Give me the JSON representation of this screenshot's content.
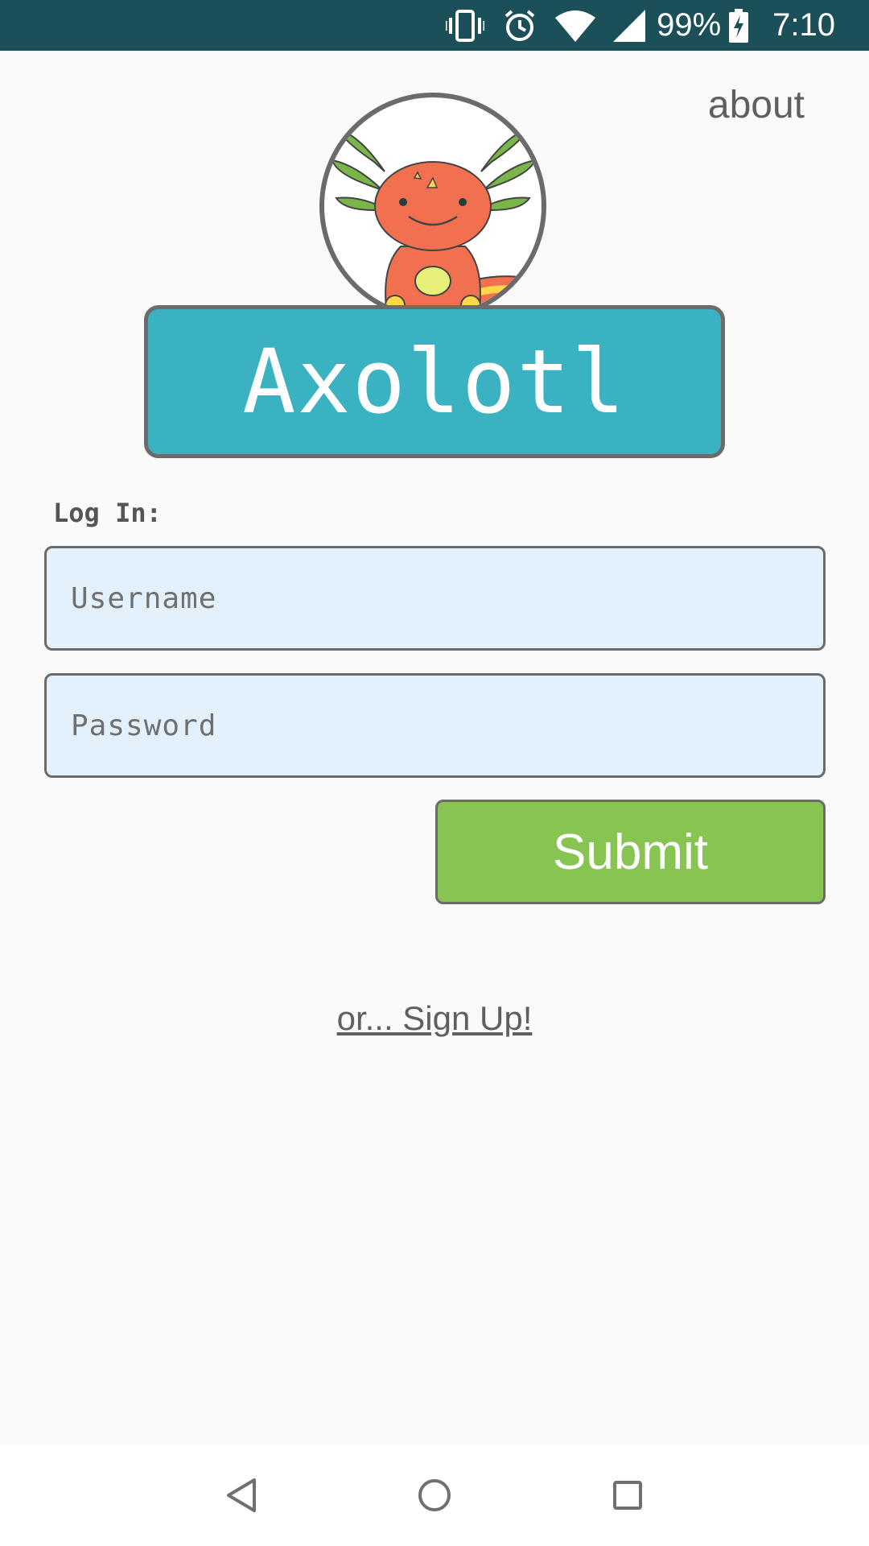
{
  "status_bar": {
    "battery_percent": "99%",
    "time": "7:10",
    "icons": [
      "vibrate-icon",
      "alarm-icon",
      "wifi-icon",
      "cell-signal-icon",
      "battery-charging-icon"
    ]
  },
  "header": {
    "about_label": "about"
  },
  "logo": {
    "title": "Axolotl",
    "mascot": "axolotl-mascot-illustration"
  },
  "login": {
    "section_label": "Log In:",
    "username_placeholder": "Username",
    "password_placeholder": "Password",
    "submit_label": "Submit",
    "signup_label": "or... Sign Up!"
  },
  "colors": {
    "status_bar": "#1c5058",
    "title_box": "#3bb2c2",
    "input_bg": "#e3f1fc",
    "submit_bg": "#88c451",
    "border": "#6b6b6b"
  },
  "nav_bar": {
    "buttons": [
      "back-icon",
      "home-icon",
      "recents-icon"
    ]
  }
}
